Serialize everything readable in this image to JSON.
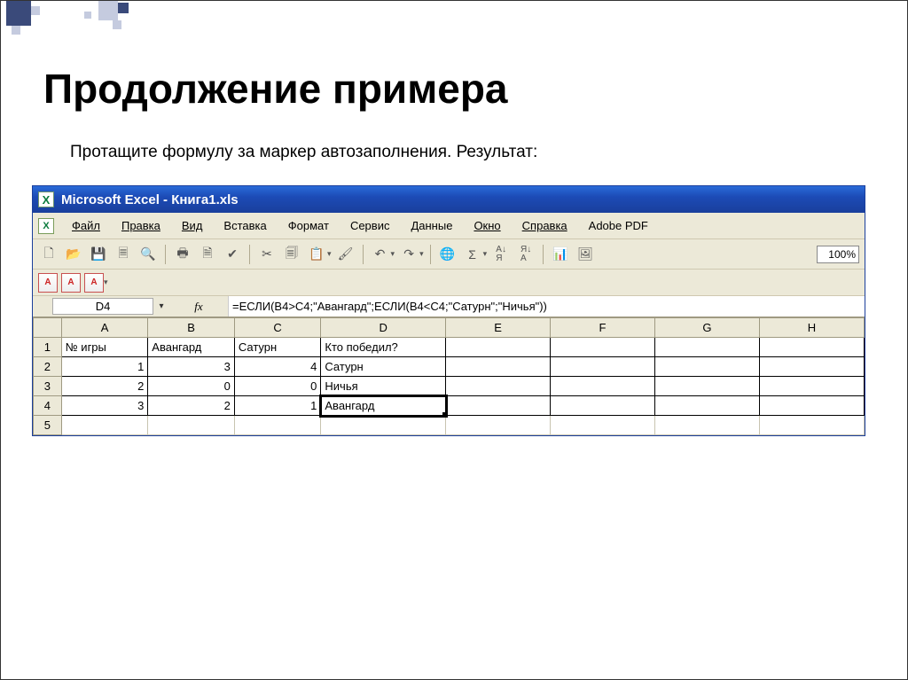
{
  "slide": {
    "title": "Продолжение примера",
    "subtext": "Протащите формулу за маркер автозаполнения. Результат:"
  },
  "window": {
    "title": "Microsoft Excel - Книга1.xls"
  },
  "menu": {
    "file": "Файл",
    "edit": "Правка",
    "view": "Вид",
    "insert": "Вставка",
    "format": "Формат",
    "tools": "Сервис",
    "data": "Данные",
    "window": "Окно",
    "help": "Справка",
    "adobe": "Adobe PDF"
  },
  "toolbar": {
    "zoom": "100%"
  },
  "formula": {
    "cell_ref": "D4",
    "fx_label": "fx",
    "text": "=ЕСЛИ(B4>C4;\"Авангард\";ЕСЛИ(B4<C4;\"Сатурн\";\"Ничья\"))"
  },
  "columns": [
    "A",
    "B",
    "C",
    "D",
    "E",
    "F",
    "G",
    "H"
  ],
  "row_numbers": [
    "1",
    "2",
    "3",
    "4",
    "5"
  ],
  "sheet": {
    "headers": {
      "a": "№ игры",
      "b": "Авангард",
      "c": "Сатурн",
      "d": "Кто победил?"
    },
    "rows": [
      {
        "a": "1",
        "b": "3",
        "c": "4",
        "d": "Сатурн"
      },
      {
        "a": "2",
        "b": "0",
        "c": "0",
        "d": "Ничья"
      },
      {
        "a": "3",
        "b": "2",
        "c": "1",
        "d": "Авангард"
      }
    ]
  }
}
